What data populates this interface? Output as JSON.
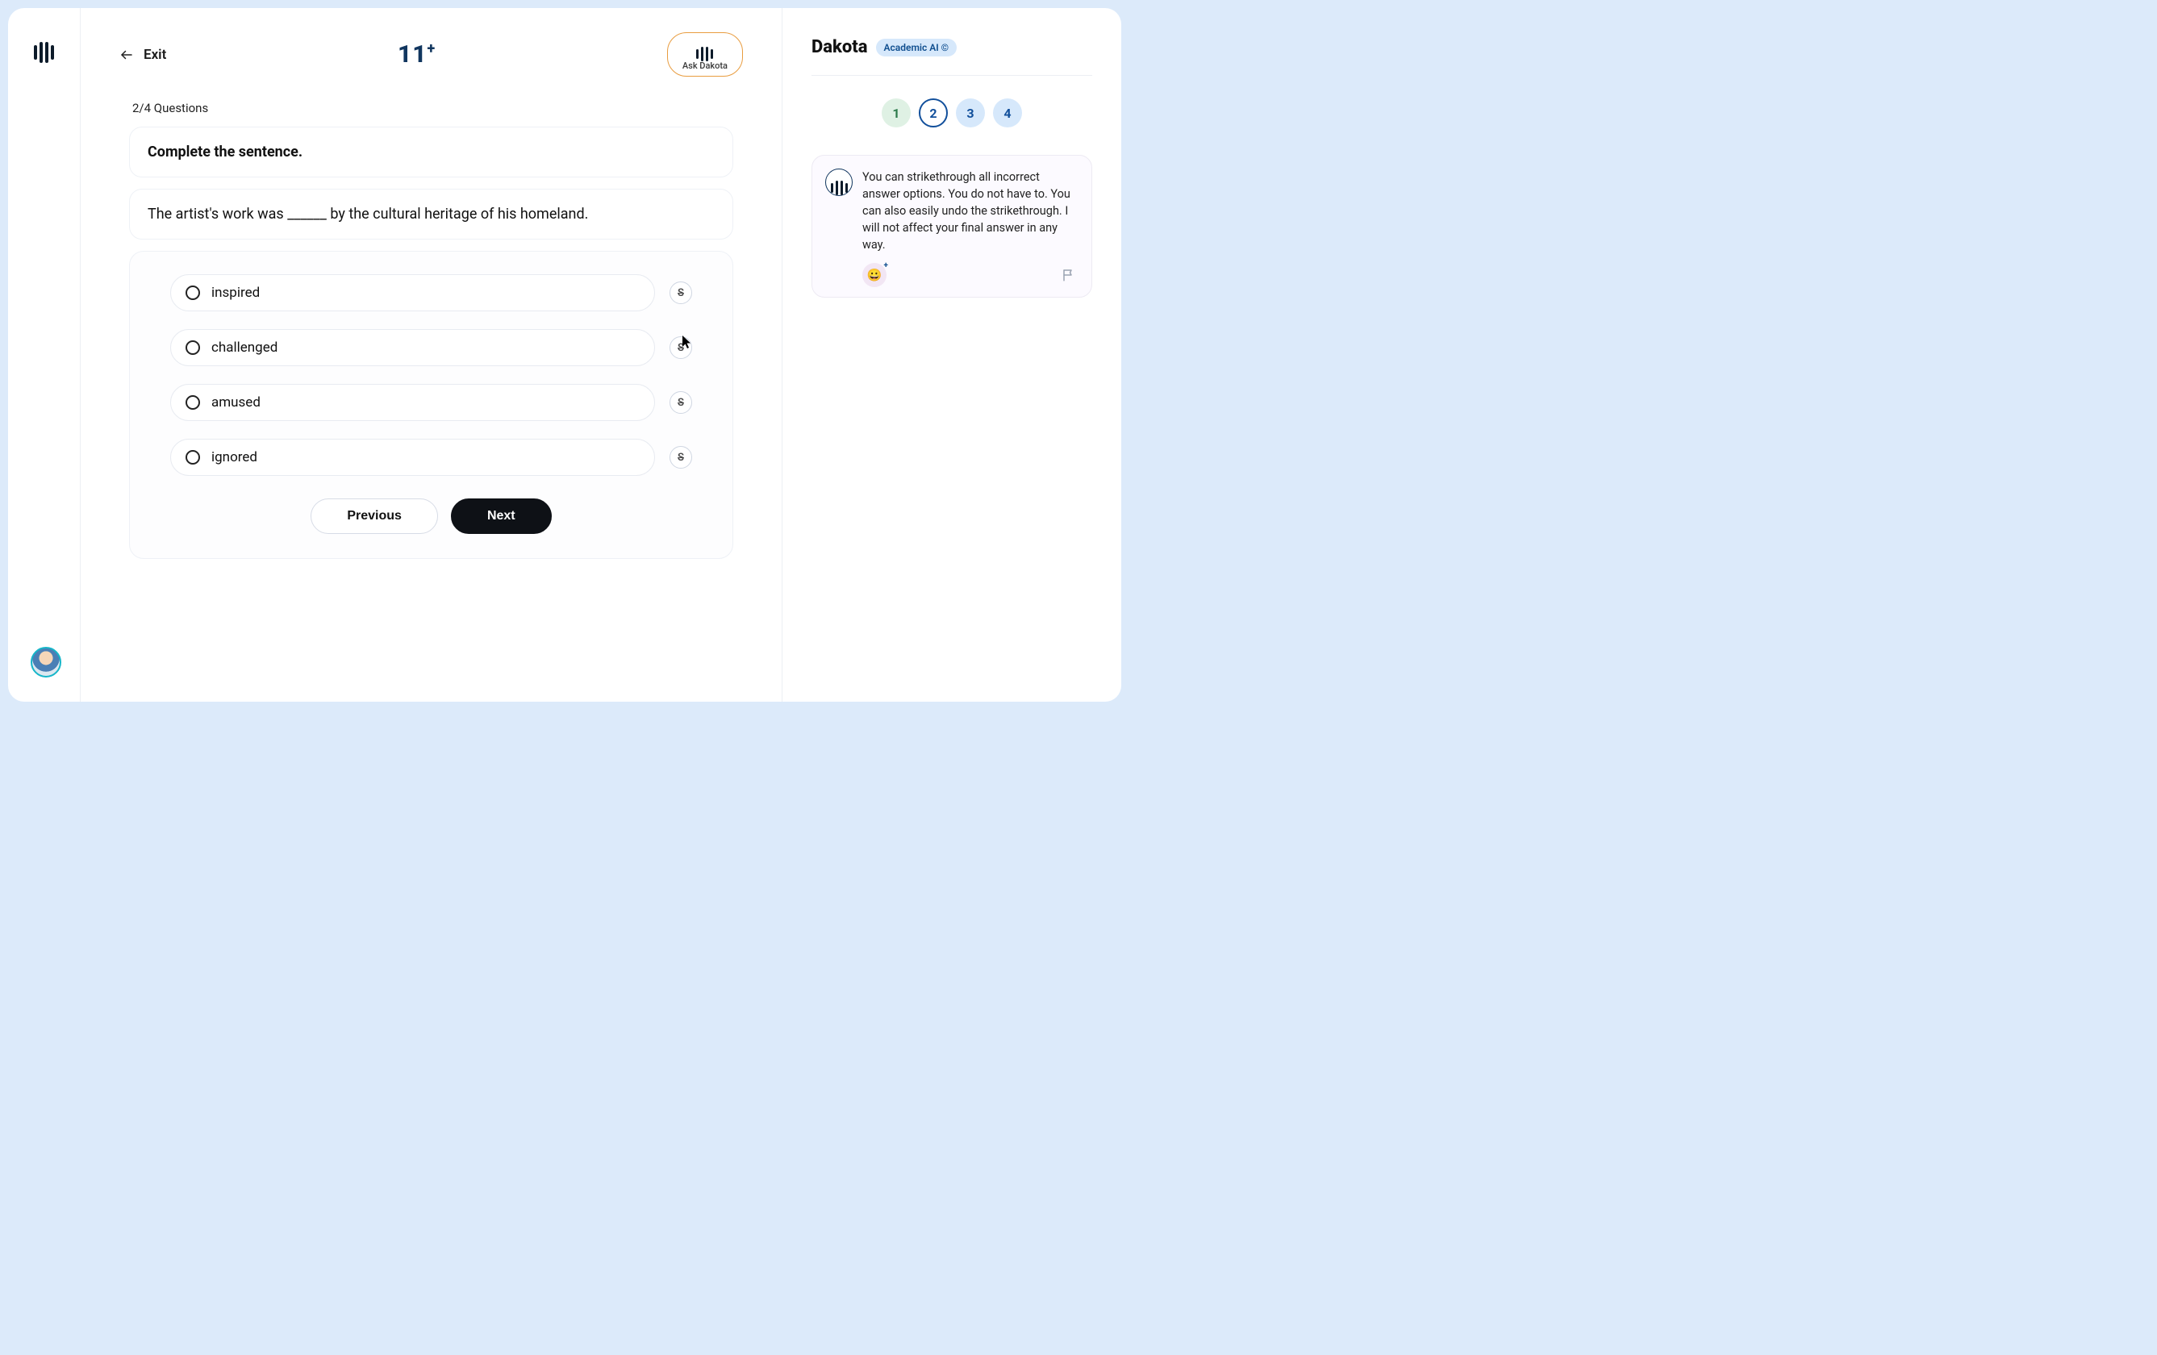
{
  "header": {
    "exit_label": "Exit",
    "title": "11",
    "title_suffix": "+",
    "ask_dakota_label": "Ask Dakota"
  },
  "progress": {
    "question_count": "2/4 Questions"
  },
  "question": {
    "instruction": "Complete the sentence.",
    "sentence": "The artist's work was ______ by the cultural heritage of his homeland."
  },
  "answers": [
    {
      "label": "inspired"
    },
    {
      "label": "challenged"
    },
    {
      "label": "amused"
    },
    {
      "label": "ignored"
    }
  ],
  "nav": {
    "prev": "Previous",
    "next": "Next"
  },
  "side": {
    "name": "Dakota",
    "badge": "Academic AI ©",
    "steps": [
      "1",
      "2",
      "3",
      "4"
    ],
    "current_step_index": 1,
    "message": "You can strikethrough all incorrect answer options. You do not have to. You can also easily undo the strikethrough. I will not affect your final answer in any way."
  }
}
